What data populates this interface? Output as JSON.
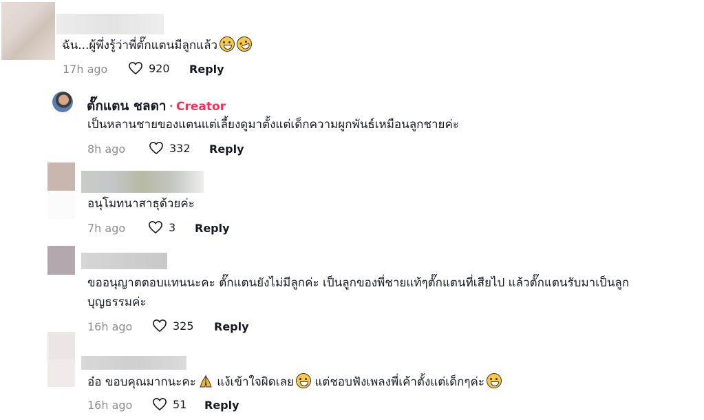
{
  "comments": [
    {
      "text": "ฉัน...ผู้พึ่งรู้ว่าพี่ตั๊กแตนมีลูกแล้ว",
      "emojis": [
        "grin-sweat-icon",
        "laugh-tears-icon"
      ],
      "time": "17h ago",
      "likes": "920",
      "reply": "Reply"
    },
    {
      "author": "ตั๊กแตน ชลดา",
      "separator": "·",
      "badge": "Creator",
      "text": "เป็นหลานชายของแตนแต่เลี้ยงดูมาตั้งแต่เด็กความผูกพันธ์เหมือนลูกชายค่ะ",
      "time": "8h ago",
      "likes": "332",
      "reply": "Reply"
    },
    {
      "text": "อนุโมทนาสาธุด้วยค่ะ",
      "time": "7h ago",
      "likes": "3",
      "reply": "Reply"
    },
    {
      "text_line1": "ขออนุญาตตอบแทนนะคะ ตั๊กแตนยังไม่มีลูกค่ะ เป็นลูกของพี่ชายแท้ๆตั๊กแตนที่เสียไป แล้วตั๊กแตนรับมาเป็นลูก",
      "text_line2": "บุญธรรมค่ะ",
      "time": "16h ago",
      "likes": "325",
      "reply": "Reply"
    },
    {
      "text_part1": "อ๋อ ขอบคุณมากนะคะ",
      "text_part2": " แง้เข้าใจผิดเลย",
      "text_part3": " แต่ชอบฟังเพลงพี่เค้าตั้งแต่เด็กๆค่ะ",
      "emojis": [
        "pray-icon",
        "grin-sweat-icon",
        "grin-icon"
      ],
      "time": "16h ago",
      "likes": "51",
      "reply": "Reply"
    }
  ],
  "colors": {
    "creator": "#fe2c55",
    "meta": "#8a8b91",
    "text": "#161823"
  }
}
